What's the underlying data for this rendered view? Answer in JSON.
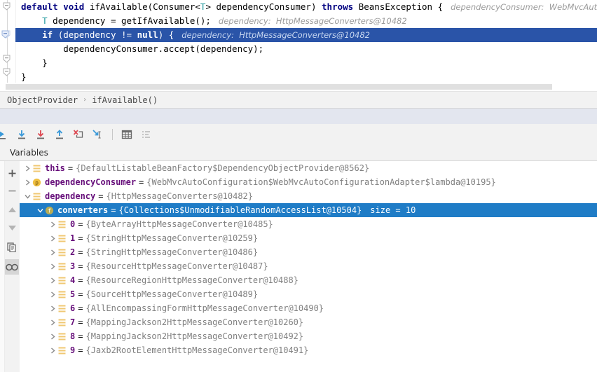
{
  "editor": {
    "lines": [
      {
        "id": "line-signature",
        "executing": false,
        "indent": 0,
        "segments": [
          {
            "t": "kw",
            "s": "default"
          },
          {
            "t": "p",
            "s": " "
          },
          {
            "t": "kw",
            "s": "void"
          },
          {
            "t": "p",
            "s": " ifAvailable(Consumer<"
          },
          {
            "t": "typ",
            "s": "T"
          },
          {
            "t": "p",
            "s": "> dependencyConsumer) "
          },
          {
            "t": "kw",
            "s": "throws"
          },
          {
            "t": "p",
            "s": " BeansException {"
          }
        ],
        "hint": "dependencyConsumer:  WebMvcAutoConf"
      },
      {
        "id": "line-get-if-available",
        "executing": false,
        "indent": 1,
        "segments": [
          {
            "t": "typ",
            "s": "T"
          },
          {
            "t": "p",
            "s": " dependency = getIfAvailable();"
          }
        ],
        "hint": "dependency:  HttpMessageConverters@10482"
      },
      {
        "id": "line-null-check",
        "executing": true,
        "indent": 1,
        "segments": [
          {
            "t": "kw",
            "s": "if"
          },
          {
            "t": "p",
            "s": " (dependency != "
          },
          {
            "t": "kw",
            "s": "null"
          },
          {
            "t": "p",
            "s": ") {"
          }
        ],
        "hint": "dependency:  HttpMessageConverters@10482"
      },
      {
        "id": "line-accept-call",
        "executing": false,
        "indent": 2,
        "segments": [
          {
            "t": "p",
            "s": "dependencyConsumer.accept(dependency);"
          }
        ],
        "hint": ""
      },
      {
        "id": "line-close-if",
        "executing": false,
        "indent": 1,
        "segments": [
          {
            "t": "p",
            "s": "}"
          }
        ],
        "hint": ""
      },
      {
        "id": "line-close-method",
        "executing": false,
        "indent": 0,
        "segments": [
          {
            "t": "p",
            "s": "}"
          }
        ],
        "hint": ""
      }
    ]
  },
  "breadcrumb": {
    "class_name": "ObjectProvider",
    "separator": "›",
    "method_name": "ifAvailable()"
  },
  "toolbar": {
    "buttons": [
      {
        "name": "show-execution-point-icon",
        "title": "Show Execution Point",
        "enabled": true
      },
      {
        "name": "step-over-icon",
        "title": "Step Over",
        "enabled": true
      },
      {
        "name": "step-into-icon",
        "title": "Step Into",
        "enabled": true
      },
      {
        "name": "step-out-icon",
        "title": "Step Out",
        "enabled": true
      },
      {
        "name": "force-step-into-icon",
        "title": "Force Step Into",
        "enabled": true
      },
      {
        "name": "run-to-cursor-icon",
        "title": "Run to Cursor",
        "enabled": true
      },
      {
        "name": "evaluate-expression-icon",
        "title": "Evaluate Expression",
        "enabled": true
      },
      {
        "name": "sort-values-icon",
        "title": "Sort Values",
        "enabled": false
      }
    ]
  },
  "panel": {
    "title": "Variables"
  },
  "rail": {
    "buttons": [
      {
        "name": "add-watch-icon",
        "glyph": "+",
        "active": false
      },
      {
        "name": "remove-watch-icon",
        "glyph": "−",
        "active": false
      },
      {
        "name": "move-up-icon",
        "glyph": "▲",
        "active": false
      },
      {
        "name": "move-down-icon",
        "glyph": "▼",
        "active": false
      },
      {
        "name": "copy-value-icon",
        "glyph": "copy",
        "active": false
      },
      {
        "name": "watches-icon",
        "glyph": "glasses",
        "active": true
      }
    ]
  },
  "variables": {
    "rows": [
      {
        "id": "var-this",
        "depth": 0,
        "expander": "collapsed",
        "badge": "local",
        "name": "this",
        "eq": "=",
        "value": "{DefaultListableBeanFactory$DependencyObjectProvider@8562}",
        "size": "",
        "selected": false
      },
      {
        "id": "var-dependency-consumer",
        "depth": 0,
        "expander": "collapsed",
        "badge": "param",
        "name": "dependencyConsumer",
        "eq": "=",
        "value": "{WebMvcAutoConfiguration$WebMvcAutoConfigurationAdapter$lambda@10195}",
        "size": "",
        "selected": false
      },
      {
        "id": "var-dependency",
        "depth": 0,
        "expander": "expanded",
        "badge": "local",
        "name": "dependency",
        "eq": "=",
        "value": "{HttpMessageConverters@10482}",
        "size": "",
        "selected": false
      },
      {
        "id": "var-converters",
        "depth": 1,
        "expander": "expanded",
        "badge": "field",
        "name": "converters",
        "eq": "=",
        "value": "{Collections$UnmodifiableRandomAccessList@10504}",
        "size": "size = 10",
        "selected": true
      },
      {
        "id": "var-index-0",
        "depth": 2,
        "expander": "collapsed",
        "badge": "local",
        "name": "0",
        "eq": "=",
        "value": "{ByteArrayHttpMessageConverter@10485}",
        "size": "",
        "selected": false
      },
      {
        "id": "var-index-1",
        "depth": 2,
        "expander": "collapsed",
        "badge": "local",
        "name": "1",
        "eq": "=",
        "value": "{StringHttpMessageConverter@10259}",
        "size": "",
        "selected": false
      },
      {
        "id": "var-index-2",
        "depth": 2,
        "expander": "collapsed",
        "badge": "local",
        "name": "2",
        "eq": "=",
        "value": "{StringHttpMessageConverter@10486}",
        "size": "",
        "selected": false
      },
      {
        "id": "var-index-3",
        "depth": 2,
        "expander": "collapsed",
        "badge": "local",
        "name": "3",
        "eq": "=",
        "value": "{ResourceHttpMessageConverter@10487}",
        "size": "",
        "selected": false
      },
      {
        "id": "var-index-4",
        "depth": 2,
        "expander": "collapsed",
        "badge": "local",
        "name": "4",
        "eq": "=",
        "value": "{ResourceRegionHttpMessageConverter@10488}",
        "size": "",
        "selected": false
      },
      {
        "id": "var-index-5",
        "depth": 2,
        "expander": "collapsed",
        "badge": "local",
        "name": "5",
        "eq": "=",
        "value": "{SourceHttpMessageConverter@10489}",
        "size": "",
        "selected": false
      },
      {
        "id": "var-index-6",
        "depth": 2,
        "expander": "collapsed",
        "badge": "local",
        "name": "6",
        "eq": "=",
        "value": "{AllEncompassingFormHttpMessageConverter@10490}",
        "size": "",
        "selected": false
      },
      {
        "id": "var-index-7",
        "depth": 2,
        "expander": "collapsed",
        "badge": "local",
        "name": "7",
        "eq": "=",
        "value": "{MappingJackson2HttpMessageConverter@10260}",
        "size": "",
        "selected": false
      },
      {
        "id": "var-index-8",
        "depth": 2,
        "expander": "collapsed",
        "badge": "local",
        "name": "8",
        "eq": "=",
        "value": "{MappingJackson2HttpMessageConverter@10492}",
        "size": "",
        "selected": false
      },
      {
        "id": "var-index-9",
        "depth": 2,
        "expander": "collapsed",
        "badge": "local",
        "name": "9",
        "eq": "=",
        "value": "{Jaxb2RootElementHttpMessageConverter@10491}",
        "size": "",
        "selected": false
      }
    ]
  },
  "colors": {
    "execution_line_bg": "#2a54a8",
    "selected_row_bg": "#1f7cc6",
    "keyword": "#000080",
    "variable_name": "#660e7a",
    "value_text": "#808080",
    "inline_hint": "#9a9a9a",
    "toolbar_bg": "#f2f2f2",
    "type_param": "#20999d"
  }
}
